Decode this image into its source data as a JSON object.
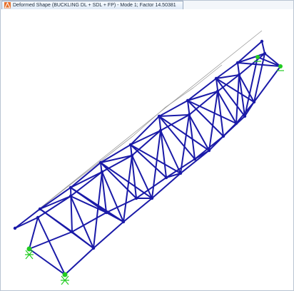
{
  "window": {
    "tab_title": "Deformed Shape (BUCKLING DL + SDL + FP) - Mode 1; Factor 14.50381",
    "tab_icon": "structure-view-icon"
  },
  "view": {
    "background": "#ffffff",
    "member_color": "#1a1aa8",
    "undeformed_color": "#9a9a9a",
    "support_color": "#22cc22"
  }
}
